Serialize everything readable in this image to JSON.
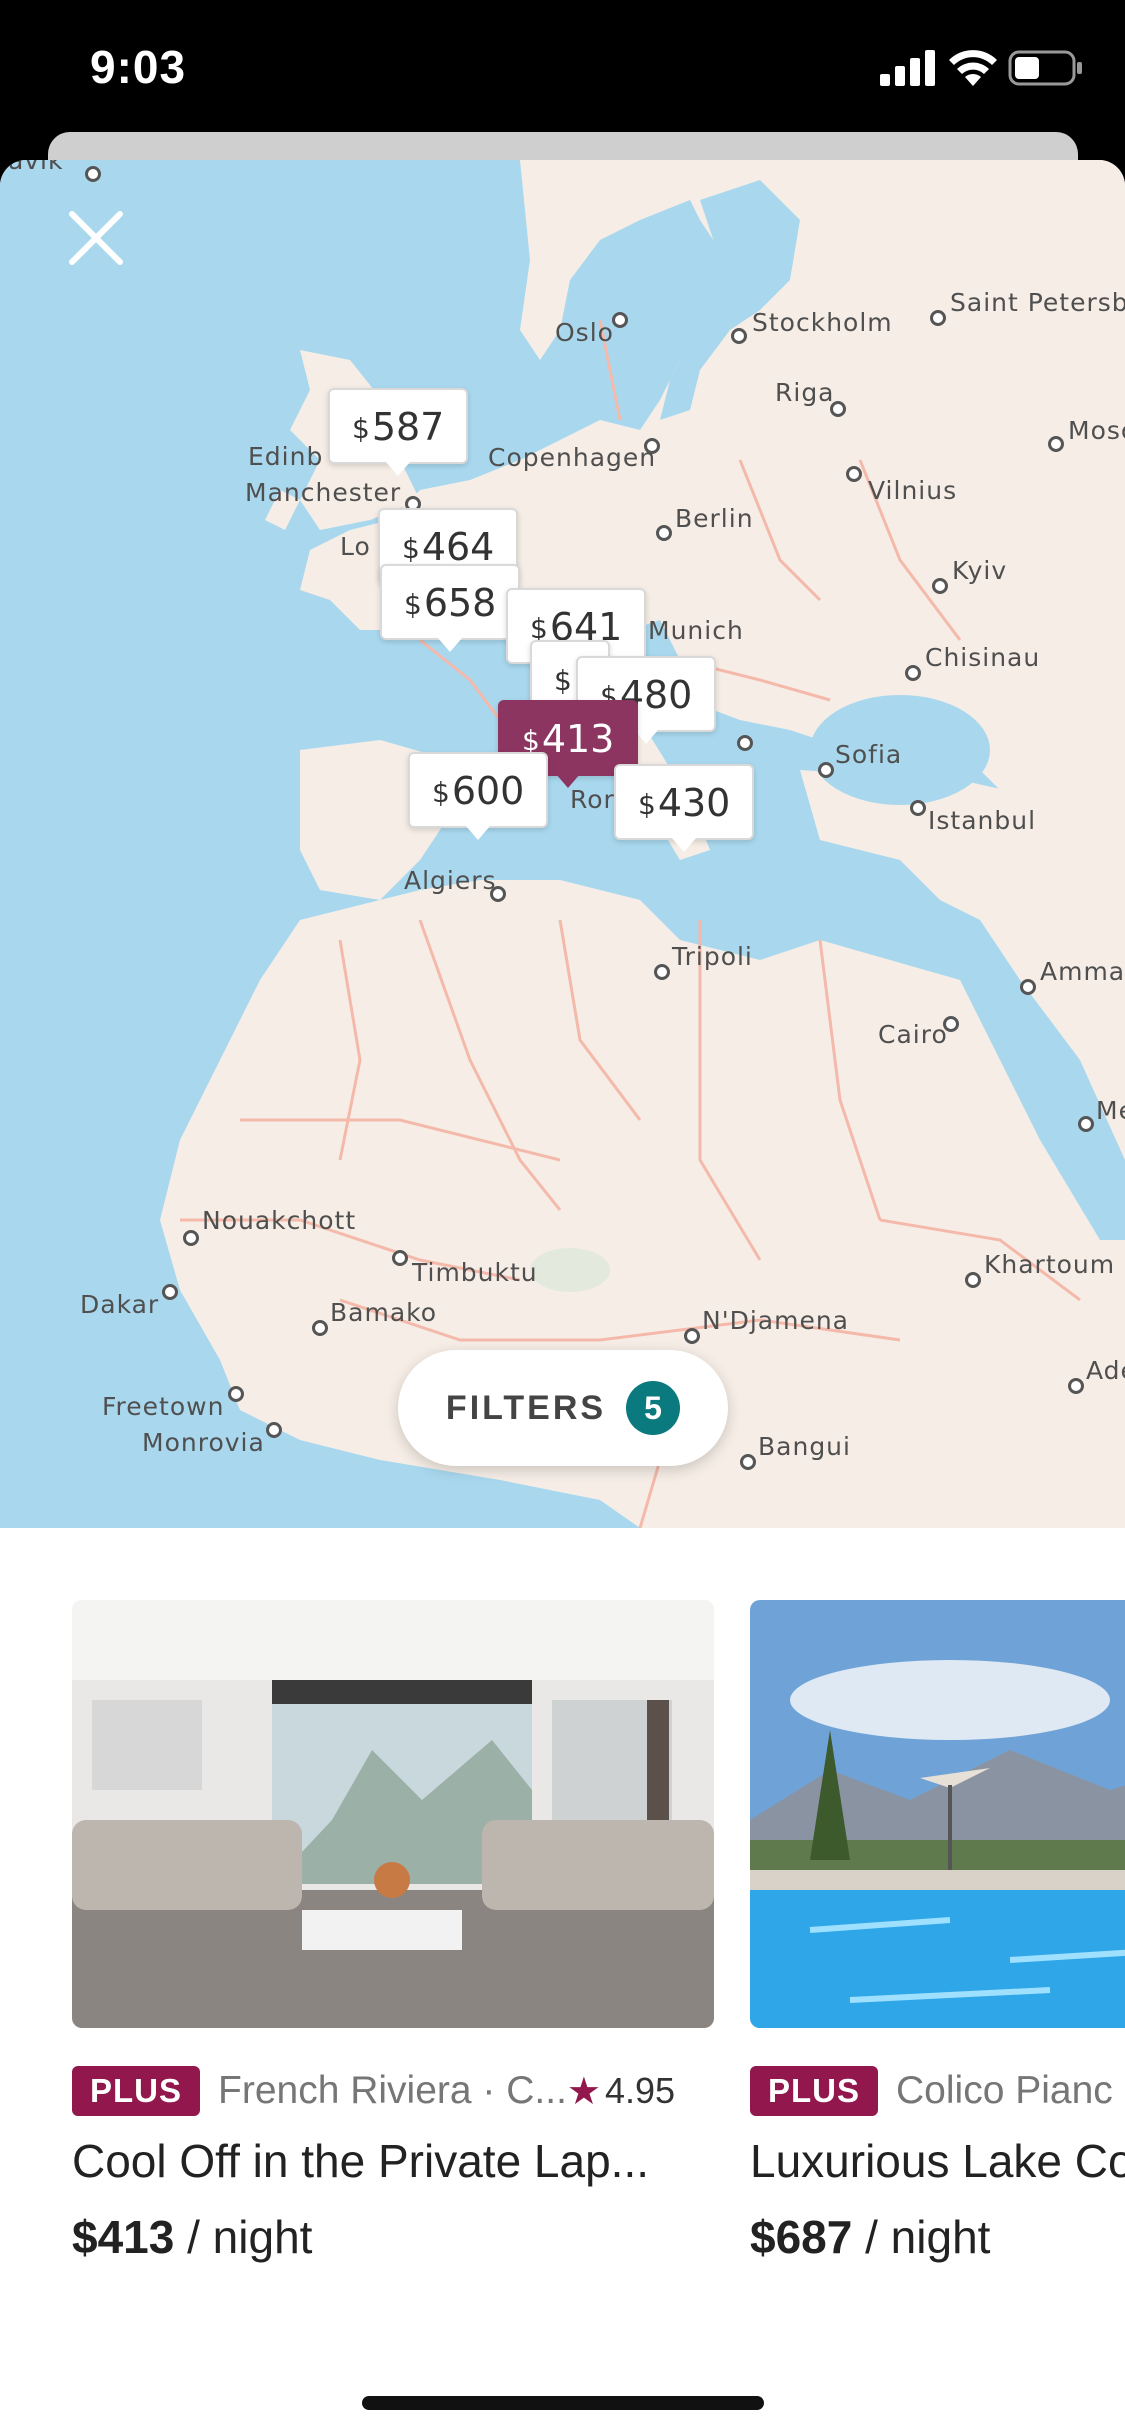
{
  "status_bar": {
    "time": "9:03"
  },
  "map": {
    "cities": [
      "javik",
      "Oslo",
      "Stockholm",
      "Saint Petersbu",
      "Riga",
      "Mosc",
      "Edinb",
      "Copenhagen",
      "Manchester",
      "Vilnius",
      "Berlin",
      "Lo",
      "Kyiv",
      "Munich",
      "Chisinau",
      "Sofia",
      "Ror",
      "Istanbul",
      "Algiers",
      "Tripoli",
      "Amman",
      "Cairo",
      "Me",
      "Nouakchott",
      "Timbuktu",
      "Dakar",
      "Khartoum",
      "Bamako",
      "N'Djamena",
      "Freetown",
      "Monrovia",
      "Ade",
      "Bangui"
    ],
    "price_pins": [
      {
        "currency": "$",
        "amount": "587"
      },
      {
        "currency": "$",
        "amount": "464"
      },
      {
        "currency": "$",
        "amount": "658"
      },
      {
        "currency": "$",
        "amount": "641"
      },
      {
        "currency": "$",
        "amount": ""
      },
      {
        "currency": "$",
        "amount": "480"
      },
      {
        "currency": "$",
        "amount": "413"
      },
      {
        "currency": "$",
        "amount": "600"
      },
      {
        "currency": "$",
        "amount": "430"
      }
    ]
  },
  "filters": {
    "label": "FILTERS",
    "count": "5"
  },
  "listings": [
    {
      "badge": "PLUS",
      "location": "French Riviera · C...",
      "rating": "4.95",
      "title": "Cool Off in the Private Lap...",
      "price": "$413",
      "price_unit": " / night"
    },
    {
      "badge": "PLUS",
      "location": "Colico Pianc",
      "rating": "",
      "title": "Luxurious Lake Co",
      "price": "$687",
      "price_unit": " / night"
    }
  ],
  "colors": {
    "accent": "#92174d",
    "active_pin": "#8c3561",
    "filters_badge": "#0b7a7f",
    "water": "#a9d8ee",
    "land": "#f6eee6"
  },
  "icons": {
    "close": "close-icon",
    "star": "star-icon",
    "signal": "signal-icon",
    "wifi": "wifi-icon",
    "battery": "battery-icon"
  }
}
